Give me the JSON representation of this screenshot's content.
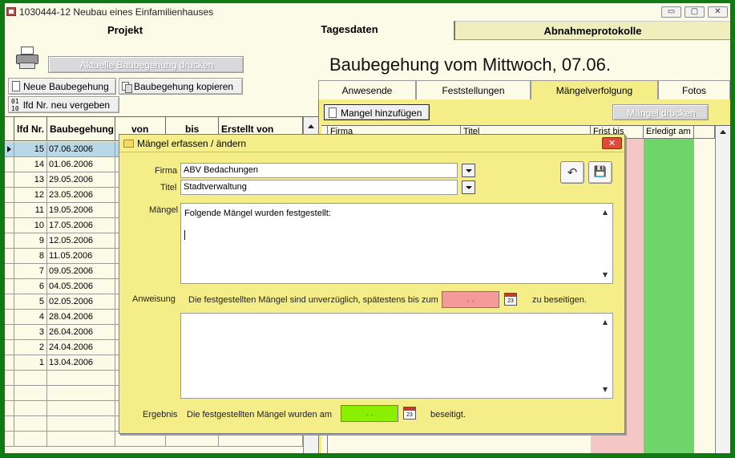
{
  "window": {
    "title": "1030444-12 Neubau eines Einfamilienhauses",
    "buttons": {
      "minimize": "▭",
      "restore": "▢",
      "close": "✕"
    }
  },
  "main_tabs": [
    {
      "label": "Projekt"
    },
    {
      "label": "Tagesdaten"
    },
    {
      "label": "Abnahmeprotokolle"
    }
  ],
  "left": {
    "print_button": "Aktuelle Baubegehung drucken",
    "new_button": "Neue Baubegehung",
    "copy_button": "Baubegehung kopieren",
    "renumber_button": "lfd Nr. neu vergeben",
    "columns": [
      "lfd Nr.",
      "Baubegehung",
      "von",
      "bis",
      "Erstellt von"
    ],
    "rows": [
      {
        "nr": "15",
        "date": "07.06.2006"
      },
      {
        "nr": "14",
        "date": "01.06.2006"
      },
      {
        "nr": "13",
        "date": "29.05.2006"
      },
      {
        "nr": "12",
        "date": "23.05.2006"
      },
      {
        "nr": "11",
        "date": "19.05.2006"
      },
      {
        "nr": "10",
        "date": "17.05.2006"
      },
      {
        "nr": "9",
        "date": "12.05.2006"
      },
      {
        "nr": "8",
        "date": "11.05.2006"
      },
      {
        "nr": "7",
        "date": "09.05.2006"
      },
      {
        "nr": "6",
        "date": "04.05.2006"
      },
      {
        "nr": "5",
        "date": "02.05.2006"
      },
      {
        "nr": "4",
        "date": "28.04.2006"
      },
      {
        "nr": "3",
        "date": "26.04.2006"
      },
      {
        "nr": "2",
        "date": "24.04.2006"
      },
      {
        "nr": "1",
        "date": "13.04.2006"
      }
    ]
  },
  "right": {
    "heading": "Baubegehung vom Mittwoch, 07.06.",
    "tabs": [
      "Anwesende",
      "Feststellungen",
      "Mängelverfolgung",
      "Fotos"
    ],
    "add_button": "Mangel hinzufügen",
    "print_button": "Mängel drucken",
    "columns": [
      "Firma",
      "Titel",
      "Frist bis",
      "Erledigt am"
    ]
  },
  "dialog": {
    "title": "Mängel erfassen / ändern",
    "firma_label": "Firma",
    "firma_value": "ABV Bedachungen",
    "titel_label": "Titel",
    "titel_value": "Stadtverwaltung",
    "maengel_label": "Mängel",
    "maengel_text": "Folgende Mängel wurden festgestellt:",
    "anweisung_label": "Anweisung",
    "anweisung_text_before": "Die festgestellten Mängel sind unverzüglich, spätestens bis zum",
    "anweisung_date": ". .",
    "anweisung_text_after": "zu beseitigen.",
    "ergebnis_label": "Ergebnis",
    "ergebnis_text_before": "Die festgestellten Mängel wurden am",
    "ergebnis_date": ". .",
    "ergebnis_text_after": "beseitigt.",
    "calendar_label": "23",
    "close_glyph": "✕",
    "undo_glyph": "↶",
    "save_glyph": "💾",
    "colors": {
      "deadline": "#f49a9a",
      "done": "#8af000"
    }
  }
}
